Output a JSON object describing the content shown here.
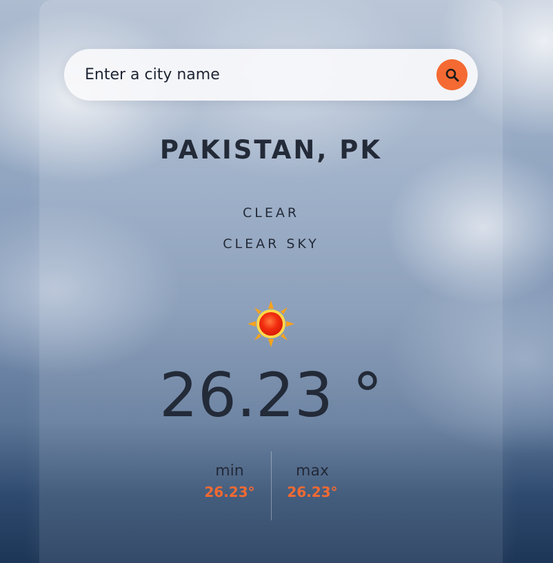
{
  "search": {
    "placeholder": "Enter a city name"
  },
  "location": {
    "label": "PAKISTAN, PK"
  },
  "weather": {
    "main": "CLEAR",
    "description": "CLEAR SKY",
    "icon": "sun-icon",
    "temperature": "26.23 °"
  },
  "range": {
    "min_label": "min",
    "min_value": "26.23°",
    "max_label": "max",
    "max_value": "26.23°"
  },
  "colors": {
    "accent": "#f46a32",
    "text": "#232a38"
  }
}
